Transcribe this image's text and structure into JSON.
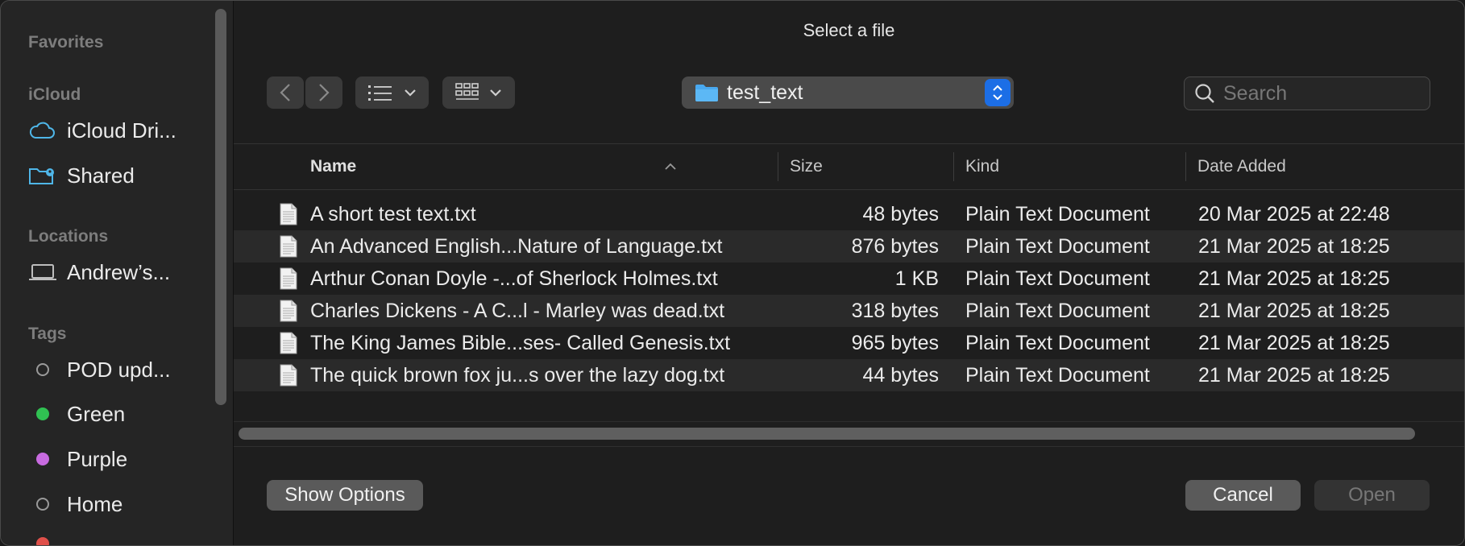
{
  "dialog": {
    "title": "Select a file"
  },
  "sidebar": {
    "favorites_label": "Favorites",
    "icloud_label": "iCloud",
    "icloud_items": [
      {
        "label": "iCloud Dri...",
        "icon": "cloud-icon"
      },
      {
        "label": "Shared",
        "icon": "shared-folder-icon"
      }
    ],
    "locations_label": "Locations",
    "locations_items": [
      {
        "label": "Andrew’s...",
        "icon": "laptop-icon"
      }
    ],
    "tags_label": "Tags",
    "tags": [
      {
        "label": "POD upd...",
        "color": "none"
      },
      {
        "label": "Green",
        "color": "#30c152"
      },
      {
        "label": "Purple",
        "color": "#c86be0"
      },
      {
        "label": "Home",
        "color": "none"
      }
    ]
  },
  "toolbar": {
    "location": "test_text",
    "search_placeholder": "Search"
  },
  "table": {
    "columns": [
      "Name",
      "Size",
      "Kind",
      "Date Added"
    ],
    "rows": [
      {
        "name": "A short test text.txt",
        "size": "48 bytes",
        "kind": "Plain Text Document",
        "date": "20 Mar 2025 at 22:48"
      },
      {
        "name": "An Advanced English...Nature of Language.txt",
        "size": "876 bytes",
        "kind": "Plain Text Document",
        "date": "21 Mar 2025 at 18:25"
      },
      {
        "name": "Arthur Conan Doyle -...of Sherlock Holmes.txt",
        "size": "1 KB",
        "kind": "Plain Text Document",
        "date": "21 Mar 2025 at 18:25"
      },
      {
        "name": "Charles Dickens - A C...l - Marley was dead.txt",
        "size": "318 bytes",
        "kind": "Plain Text Document",
        "date": "21 Mar 2025 at 18:25"
      },
      {
        "name": "The King James Bible...ses- Called Genesis.txt",
        "size": "965 bytes",
        "kind": "Plain Text Document",
        "date": "21 Mar 2025 at 18:25"
      },
      {
        "name": "The quick brown fox ju...s over the lazy dog.txt",
        "size": "44 bytes",
        "kind": "Plain Text Document",
        "date": "21 Mar 2025 at 18:25"
      }
    ]
  },
  "footer": {
    "show_options": "Show Options",
    "cancel": "Cancel",
    "open": "Open"
  }
}
